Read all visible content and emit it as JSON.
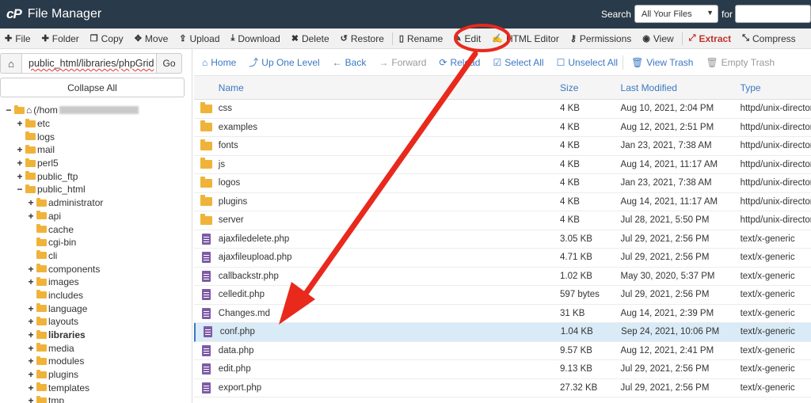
{
  "header": {
    "logo": "cP",
    "title": "File Manager",
    "search_label": "Search",
    "search_scope": "All Your Files",
    "for_label": "for",
    "search_value": ""
  },
  "toolbar": {
    "items": [
      {
        "icon": "plus-icon",
        "label": "File"
      },
      {
        "icon": "plus-icon",
        "label": "Folder"
      },
      {
        "icon": "copy-icon",
        "label": "Copy"
      },
      {
        "icon": "move-icon",
        "label": "Move"
      },
      {
        "icon": "upload-icon",
        "label": "Upload"
      },
      {
        "icon": "download-icon",
        "label": "Download"
      },
      {
        "icon": "close-icon",
        "label": "Delete"
      },
      {
        "icon": "restore-icon",
        "label": "Restore"
      },
      {
        "icon": "file-icon",
        "label": "Rename"
      },
      {
        "icon": "pencil-icon",
        "label": "Edit"
      },
      {
        "icon": "html-editor-icon",
        "label": "HTML Editor"
      },
      {
        "icon": "key-icon",
        "label": "Permissions"
      },
      {
        "icon": "eye-icon",
        "label": "View"
      },
      {
        "icon": "extract-icon",
        "label": "Extract"
      },
      {
        "icon": "compress-icon",
        "label": "Compress"
      }
    ]
  },
  "sidebar": {
    "path": "public_html/libraries/phpGrid",
    "go_label": "Go",
    "collapse_label": "Collapse All",
    "tree": [
      {
        "toggle": "−",
        "label": "(/hom",
        "level": 0,
        "home": true,
        "blurred": true
      },
      {
        "toggle": "+",
        "label": "etc",
        "level": 1
      },
      {
        "toggle": "",
        "label": "logs",
        "level": 1
      },
      {
        "toggle": "+",
        "label": "mail",
        "level": 1
      },
      {
        "toggle": "+",
        "label": "perl5",
        "level": 1
      },
      {
        "toggle": "+",
        "label": "public_ftp",
        "level": 1
      },
      {
        "toggle": "−",
        "label": "public_html",
        "level": 1
      },
      {
        "toggle": "+",
        "label": "administrator",
        "level": 2
      },
      {
        "toggle": "+",
        "label": "api",
        "level": 2
      },
      {
        "toggle": "",
        "label": "cache",
        "level": 2
      },
      {
        "toggle": "",
        "label": "cgi-bin",
        "level": 2
      },
      {
        "toggle": "",
        "label": "cli",
        "level": 2
      },
      {
        "toggle": "+",
        "label": "components",
        "level": 2
      },
      {
        "toggle": "+",
        "label": "images",
        "level": 2
      },
      {
        "toggle": "",
        "label": "includes",
        "level": 2
      },
      {
        "toggle": "+",
        "label": "language",
        "level": 2
      },
      {
        "toggle": "+",
        "label": "layouts",
        "level": 2
      },
      {
        "toggle": "+",
        "label": "libraries",
        "level": 2,
        "bold": true
      },
      {
        "toggle": "+",
        "label": "media",
        "level": 2
      },
      {
        "toggle": "+",
        "label": "modules",
        "level": 2
      },
      {
        "toggle": "+",
        "label": "plugins",
        "level": 2
      },
      {
        "toggle": "+",
        "label": "templates",
        "level": 2
      },
      {
        "toggle": "+",
        "label": "tmp",
        "level": 2
      }
    ]
  },
  "nav": {
    "items": [
      {
        "icon": "home-icon",
        "label": "Home",
        "disabled": false
      },
      {
        "icon": "level-up-icon",
        "label": "Up One Level",
        "disabled": false
      },
      {
        "icon": "arrow-left-icon",
        "label": "Back",
        "disabled": false
      },
      {
        "icon": "arrow-right-icon",
        "label": "Forward",
        "disabled": true
      },
      {
        "icon": "reload-icon",
        "label": "Reload",
        "disabled": false
      },
      {
        "icon": "checkbox-checked-icon",
        "label": "Select All",
        "disabled": false
      },
      {
        "icon": "checkbox-empty-icon",
        "label": "Unselect All",
        "disabled": false
      },
      {
        "icon": "trash-icon",
        "label": "View Trash",
        "disabled": false
      },
      {
        "icon": "trash-icon",
        "label": "Empty Trash",
        "disabled": true
      }
    ]
  },
  "table": {
    "columns": [
      "Name",
      "Size",
      "Last Modified",
      "Type"
    ],
    "rows": [
      {
        "kind": "folder",
        "name": "css",
        "size": "4 KB",
        "modified": "Aug 10, 2021, 2:04 PM",
        "type": "httpd/unix-directory"
      },
      {
        "kind": "folder",
        "name": "examples",
        "size": "4 KB",
        "modified": "Aug 12, 2021, 2:51 PM",
        "type": "httpd/unix-directory"
      },
      {
        "kind": "folder",
        "name": "fonts",
        "size": "4 KB",
        "modified": "Jan 23, 2021, 7:38 AM",
        "type": "httpd/unix-directory"
      },
      {
        "kind": "folder",
        "name": "js",
        "size": "4 KB",
        "modified": "Aug 14, 2021, 11:17 AM",
        "type": "httpd/unix-directory"
      },
      {
        "kind": "folder",
        "name": "logos",
        "size": "4 KB",
        "modified": "Jan 23, 2021, 7:38 AM",
        "type": "httpd/unix-directory"
      },
      {
        "kind": "folder",
        "name": "plugins",
        "size": "4 KB",
        "modified": "Aug 14, 2021, 11:17 AM",
        "type": "httpd/unix-directory"
      },
      {
        "kind": "folder",
        "name": "server",
        "size": "4 KB",
        "modified": "Jul 28, 2021, 5:50 PM",
        "type": "httpd/unix-directory"
      },
      {
        "kind": "file",
        "name": "ajaxfiledelete.php",
        "size": "3.05 KB",
        "modified": "Jul 29, 2021, 2:56 PM",
        "type": "text/x-generic"
      },
      {
        "kind": "file",
        "name": "ajaxfileupload.php",
        "size": "4.71 KB",
        "modified": "Jul 29, 2021, 2:56 PM",
        "type": "text/x-generic"
      },
      {
        "kind": "file",
        "name": "callbackstr.php",
        "size": "1.02 KB",
        "modified": "May 30, 2020, 5:37 PM",
        "type": "text/x-generic"
      },
      {
        "kind": "file",
        "name": "celledit.php",
        "size": "597 bytes",
        "modified": "Jul 29, 2021, 2:56 PM",
        "type": "text/x-generic"
      },
      {
        "kind": "file",
        "name": "Changes.md",
        "size": "31 KB",
        "modified": "Aug 14, 2021, 2:39 PM",
        "type": "text/x-generic"
      },
      {
        "kind": "file",
        "name": "conf.php",
        "size": "1.04 KB",
        "modified": "Sep 24, 2021, 10:06 PM",
        "type": "text/x-generic",
        "selected": true
      },
      {
        "kind": "file",
        "name": "data.php",
        "size": "9.57 KB",
        "modified": "Aug 12, 2021, 2:41 PM",
        "type": "text/x-generic"
      },
      {
        "kind": "file",
        "name": "edit.php",
        "size": "9.13 KB",
        "modified": "Jul 29, 2021, 2:56 PM",
        "type": "text/x-generic"
      },
      {
        "kind": "file",
        "name": "export.php",
        "size": "27.32 KB",
        "modified": "Jul 29, 2021, 2:56 PM",
        "type": "text/x-generic"
      }
    ]
  },
  "colors": {
    "header_bg": "#293a4a",
    "link_blue": "#3c78c3",
    "folder": "#f0b33a",
    "file": "#7d5ba6",
    "selected_row": "#d9ebf7",
    "annotation_red": "#e8291c",
    "extract_red": "#c0332b"
  }
}
